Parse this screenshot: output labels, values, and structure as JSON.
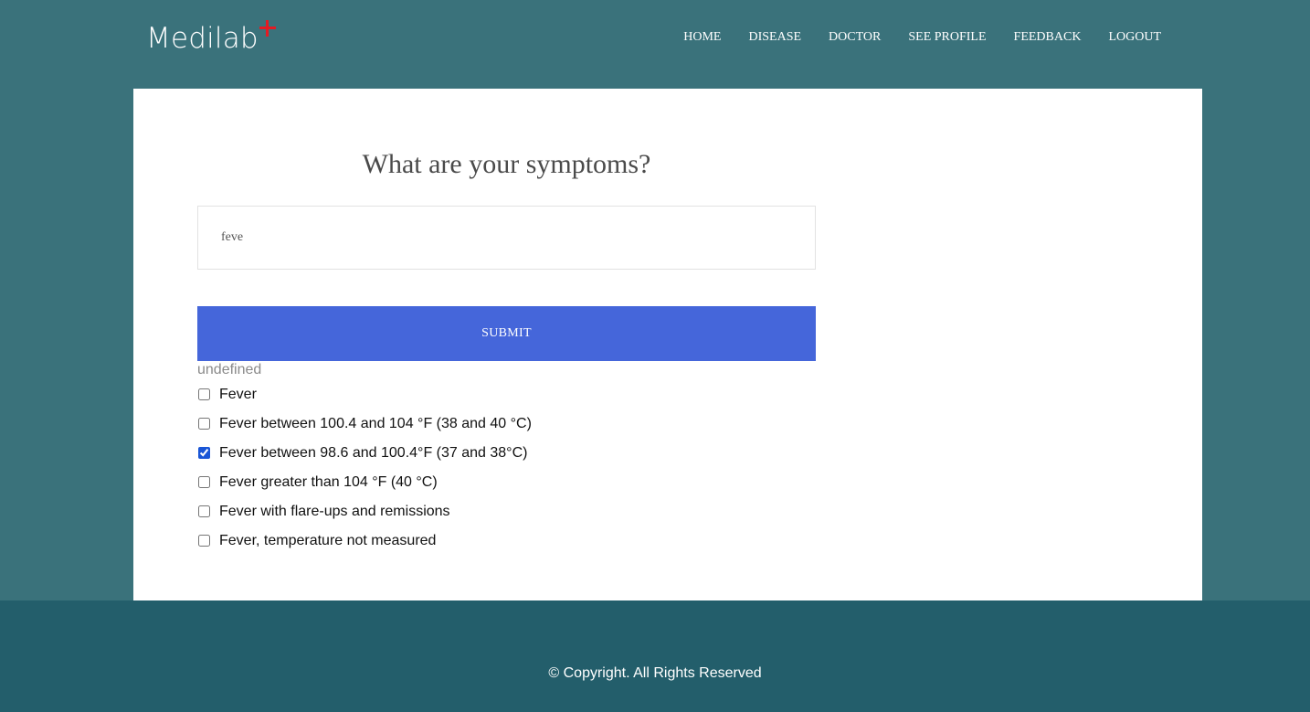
{
  "brand": {
    "name": "Medilab",
    "accent_color": "#e31b23"
  },
  "nav": {
    "items": [
      {
        "label": "HOME"
      },
      {
        "label": "DISEASE"
      },
      {
        "label": "DOCTOR"
      },
      {
        "label": "SEE PROFILE"
      },
      {
        "label": "FEEDBACK"
      },
      {
        "label": "LOGOUT"
      }
    ]
  },
  "main": {
    "title": "What are your symptoms?",
    "search_value": "feve",
    "submit_label": "SUBMIT",
    "result_note": "undefined",
    "options": [
      {
        "label": "Fever",
        "checked": false
      },
      {
        "label": "Fever between 100.4 and 104 °F (38 and 40 °C)",
        "checked": false
      },
      {
        "label": "Fever between 98.6 and 100.4°F (37 and 38°C)",
        "checked": true
      },
      {
        "label": "Fever greater than 104 °F (40 °C)",
        "checked": false
      },
      {
        "label": "Fever with flare-ups and remissions",
        "checked": false
      },
      {
        "label": "Fever, temperature not measured",
        "checked": false
      }
    ]
  },
  "footer": {
    "copyright": "© Copyright. All Rights Reserved"
  },
  "colors": {
    "page_background": "#3a727b",
    "footer_background": "#235e6b",
    "submit_button": "#4566da"
  }
}
